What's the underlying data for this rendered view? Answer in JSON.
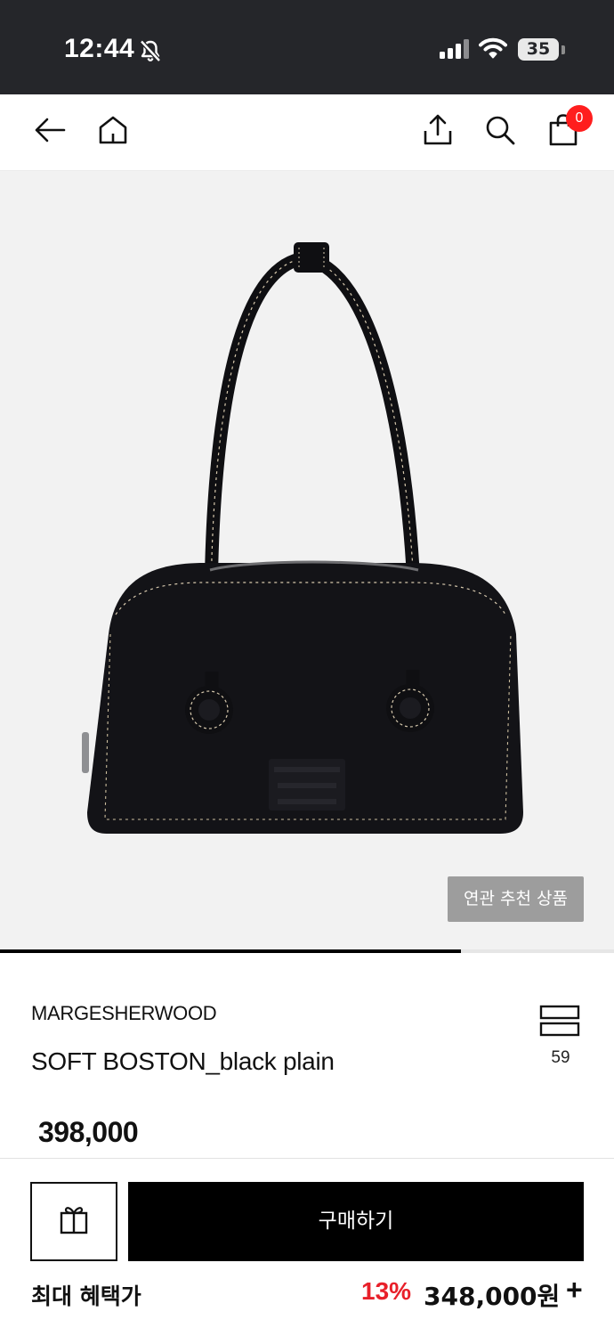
{
  "status_bar": {
    "time": "12:44",
    "battery": "35",
    "icons": [
      "bell-off-icon",
      "signal-icon",
      "wifi-icon",
      "battery-icon"
    ]
  },
  "nav": {
    "icons": [
      "back-arrow-icon",
      "home-icon",
      "share-icon",
      "search-icon",
      "shopping-bag-icon"
    ],
    "cart_count": "0"
  },
  "gallery": {
    "related_button": "연관 추천 상품",
    "progress": 0.75,
    "background": "#f2f2f2"
  },
  "product": {
    "brand": "MARGESHERWOOD",
    "name": "SOFT BOSTON_black plain",
    "wish_count": "59",
    "price": "398,000"
  },
  "bottom_bar": {
    "gift_icon": "gift-icon",
    "buy_label": "구매하기",
    "benefit_label": "최대 혜택가",
    "benefit_rate": "13%",
    "benefit_price": "348,000원",
    "expand_label": "+"
  },
  "colors": {
    "status_bar_bg": "#25262a",
    "badge": "#ff1e1e",
    "discount": "#e8202a",
    "buy_button": "#000000"
  }
}
